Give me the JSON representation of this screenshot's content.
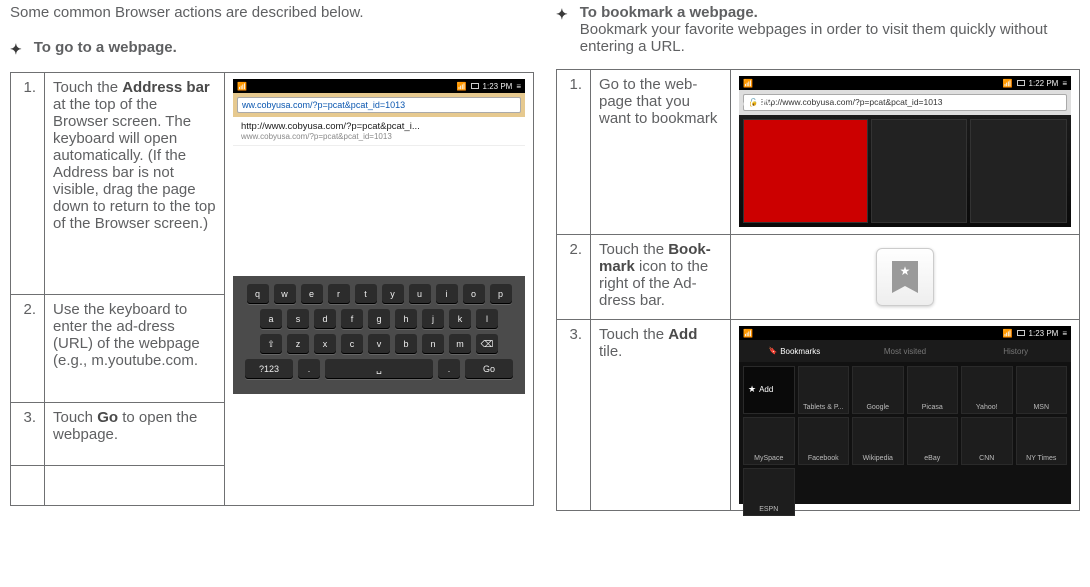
{
  "intro": "Some common Browser actions are described below.",
  "left": {
    "heading": "To go to a webpage.",
    "steps": [
      {
        "n": "1.",
        "pre": "Touch the ",
        "bold": "Address bar",
        "post": " at the top of the Browser screen. The keyboard will open automatically. (If the Address bar is not visible, drag the page down to return to the top of the Browser screen.)"
      },
      {
        "n": "2.",
        "pre": "Use the keyboard to enter the ad-dress (URL) of the webpage (e.g., m.youtube.com.",
        "bold": "",
        "post": ""
      },
      {
        "n": "3.",
        "pre": "Touch ",
        "bold": "Go",
        "post": " to open the webpage."
      }
    ],
    "screenshot": {
      "time": "1:23 PM",
      "addr_partial": "ww.cobyusa.com/?p=pcat&pcat_id=1013",
      "suggest_title": "http://www.cobyusa.com/?p=pcat&pcat_i...",
      "suggest_url": "www.cobyusa.com/?p=pcat&pcat_id=1013",
      "keys_r1": [
        "q",
        "w",
        "e",
        "r",
        "t",
        "y",
        "u",
        "i",
        "o",
        "p"
      ],
      "keys_r2": [
        "a",
        "s",
        "d",
        "f",
        "g",
        "h",
        "j",
        "k",
        "l"
      ],
      "keys_r3": [
        "⇧",
        "z",
        "x",
        "c",
        "v",
        "b",
        "n",
        "m",
        "⌫"
      ],
      "keys_r4": [
        "?123",
        ".",
        "␣",
        ".",
        "Go"
      ]
    }
  },
  "right": {
    "heading": "To bookmark a webpage.",
    "subtext": "Bookmark your favorite webpages in order to visit them quickly without entering a URL.",
    "steps": [
      {
        "n": "1.",
        "pre": "Go to the web-page that you want to bookmark",
        "bold": "",
        "post": ""
      },
      {
        "n": "2.",
        "pre": "Touch the ",
        "bold": "Book-mark",
        "post": " icon to the right of the Ad-dress bar."
      },
      {
        "n": "3.",
        "pre": "Touch the ",
        "bold": "Add",
        "post": " tile."
      }
    ],
    "screenshot1": {
      "time": "1:22 PM",
      "url": "http://www.cobyusa.com/?p=pcat&pcat_id=1013",
      "brand": "COBY"
    },
    "screenshot3": {
      "time": "1:23 PM",
      "tabs": [
        "Bookmarks",
        "Most visited",
        "History"
      ],
      "add_label": "Add",
      "row1": [
        "Tablets & P...",
        "Google",
        "Picasa",
        "Yahoo!",
        "MSN",
        "MySpace"
      ],
      "row2": [
        "Facebook",
        "Wikipedia",
        "eBay",
        "CNN",
        "NY Times",
        "ESPN"
      ]
    }
  }
}
